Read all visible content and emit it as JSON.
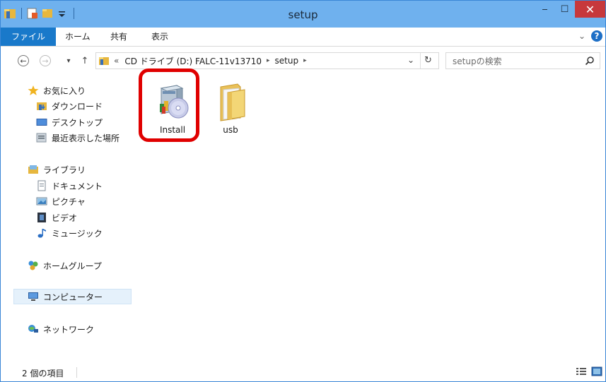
{
  "window": {
    "title": "setup",
    "min_glyph": "‒",
    "max_glyph": "☐",
    "close_glyph": "✕"
  },
  "ribbon": {
    "tabs": [
      "ファイル",
      "ホーム",
      "共有",
      "表示"
    ],
    "expand_glyph": "⌄",
    "help_glyph": "?"
  },
  "nav": {
    "back_glyph": "←",
    "forward_glyph": "→",
    "recent_glyph": "▾",
    "up_glyph": "↑",
    "address": {
      "overflow_glyph": "«",
      "crumbs": [
        "CD ドライブ (D:) FALC-11v13710",
        "setup"
      ],
      "crumb_sep_glyph": "▸",
      "dropdown_glyph": "⌄",
      "refresh_glyph": "↻"
    },
    "search_placeholder": "setupの検索"
  },
  "sidebar": {
    "favorites": {
      "label": "お気に入り",
      "items": [
        "ダウンロード",
        "デスクトップ",
        "最近表示した場所"
      ]
    },
    "libraries": {
      "label": "ライブラリ",
      "items": [
        "ドキュメント",
        "ピクチャ",
        "ビデオ",
        "ミュージック"
      ]
    },
    "homegroup": "ホームグループ",
    "computer": "コンピューター",
    "network": "ネットワーク"
  },
  "files": [
    {
      "name": "Install",
      "type": "installer",
      "highlighted": true
    },
    {
      "name": "usb",
      "type": "folder",
      "highlighted": false
    }
  ],
  "status": {
    "item_count": "2 個の項目"
  },
  "colors": {
    "titlebar": "#6fb1ee",
    "file_tab": "#1979ca",
    "close_button": "#c7383c",
    "highlight_ring": "#e00000"
  }
}
